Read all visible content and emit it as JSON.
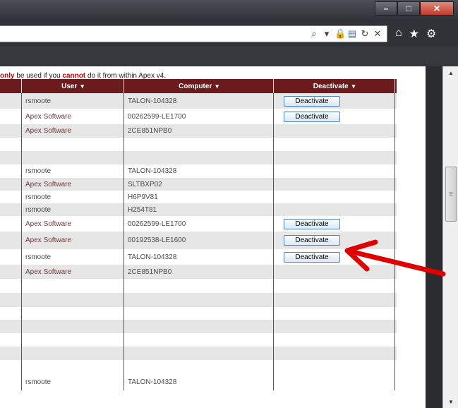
{
  "browser": {
    "window_controls": [
      "–",
      "□",
      "✕"
    ],
    "address_icons": [
      "search-icon",
      "dropdown-icon",
      "lock-icon",
      "compat-icon",
      "refresh-icon",
      "close-icon"
    ],
    "toolbar_icons": [
      "home-icon",
      "favorites-icon",
      "settings-icon"
    ]
  },
  "notice": {
    "part1": "only",
    "part2": " be used if you ",
    "part3": "cannot",
    "part4": " do it from within Apex v4."
  },
  "table": {
    "headers": [
      "User",
      "Computer",
      "Deactivate"
    ],
    "sort_icon": "▾",
    "rows": [
      {
        "user": "rsmoote",
        "computer": "TALON-104328",
        "button": "Deactivate"
      },
      {
        "user": "Apex Software",
        "computer": "00262599-LE1700",
        "button": "Deactivate"
      },
      {
        "user": "Apex Software",
        "computer": "2CE851NPB0",
        "button": ""
      },
      {
        "user": "",
        "computer": "",
        "button": ""
      },
      {
        "user": "",
        "computer": "",
        "button": ""
      },
      {
        "user": "rsmoote",
        "computer": "TALON-104328",
        "button": ""
      },
      {
        "user": "Apex Software",
        "computer": "SLTBXP02",
        "button": ""
      },
      {
        "user": "rsmoote",
        "computer": "H6P9V81",
        "button": ""
      },
      {
        "user": "rsmoote",
        "computer": "H254T81",
        "button": ""
      },
      {
        "user": "Apex Software",
        "computer": "00262599-LE1700",
        "button": "Deactivate"
      },
      {
        "user": "Apex Software",
        "computer": "00192538-LE1600",
        "button": "Deactivate"
      },
      {
        "user": "rsmoote",
        "computer": "TALON-104328",
        "button": "Deactivate"
      },
      {
        "user": "Apex Software",
        "computer": "2CE851NPB0",
        "button": ""
      },
      {
        "user": "",
        "computer": "",
        "button": ""
      },
      {
        "user": "",
        "computer": "",
        "button": ""
      },
      {
        "user": "",
        "computer": "",
        "button": ""
      },
      {
        "user": "",
        "computer": "",
        "button": ""
      },
      {
        "user": "",
        "computer": "",
        "button": ""
      },
      {
        "user": "",
        "computer": "",
        "button": ""
      },
      {
        "user": "",
        "computer": "",
        "button": ""
      },
      {
        "user": "rsmoote",
        "computer": "TALON-104328",
        "button": ""
      }
    ]
  },
  "colors": {
    "header_bg": "#6b1b1b",
    "highlight_text": "#d10000",
    "annotation_arrow": "#e00000"
  }
}
